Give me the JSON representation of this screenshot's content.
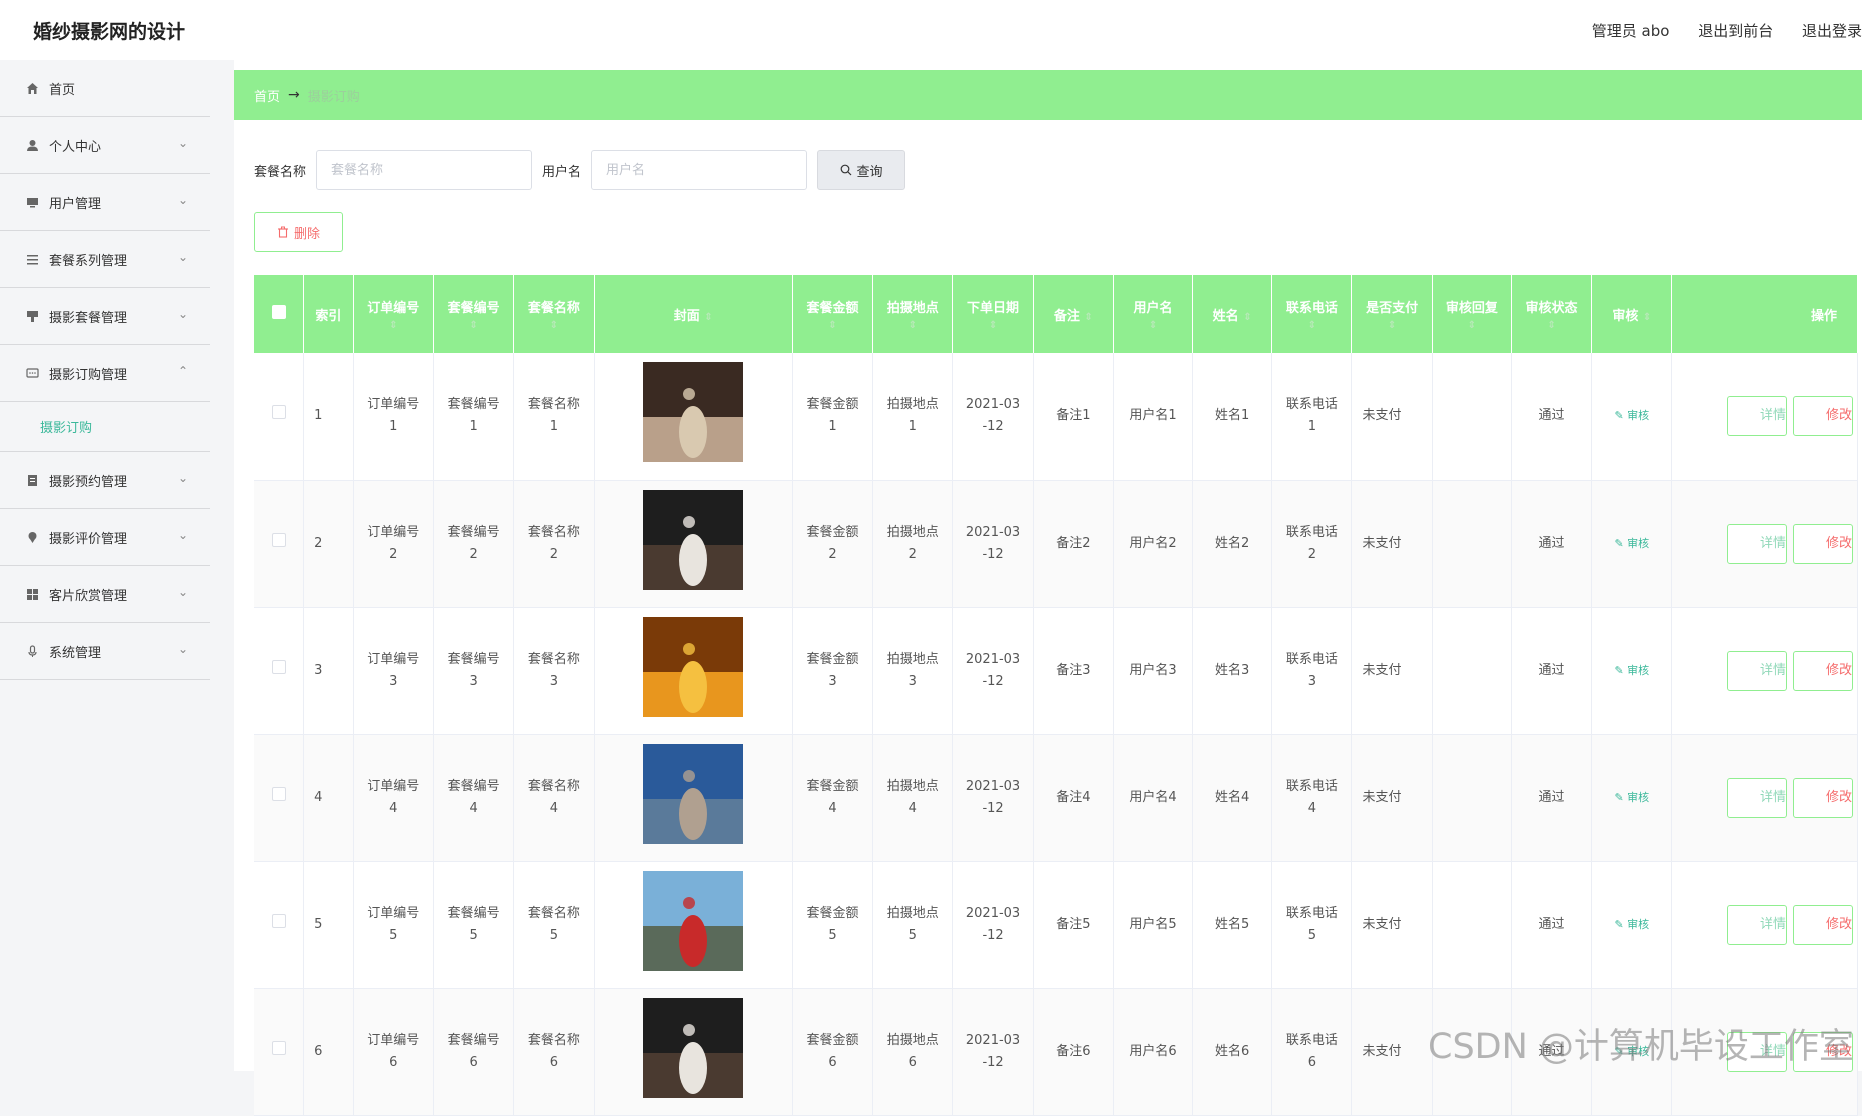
{
  "header": {
    "title": "婚纱摄影网的设计",
    "admin": "管理员 abo",
    "to_front": "退出到前台",
    "logout": "退出登录"
  },
  "sidebar": {
    "items": [
      {
        "label": "首页",
        "icon": "home-icon"
      },
      {
        "label": "个人中心",
        "icon": "user-icon"
      },
      {
        "label": "用户管理",
        "icon": "monitor-icon"
      },
      {
        "label": "套餐系列管理",
        "icon": "list-icon"
      },
      {
        "label": "摄影套餐管理",
        "icon": "brush-icon"
      },
      {
        "label": "摄影订购管理",
        "icon": "chat-icon",
        "sub": "摄影订购"
      },
      {
        "label": "摄影预约管理",
        "icon": "document-icon"
      },
      {
        "label": "摄影评价管理",
        "icon": "pin-icon"
      },
      {
        "label": "客片欣赏管理",
        "icon": "grid-icon"
      },
      {
        "label": "系统管理",
        "icon": "mic-icon"
      }
    ]
  },
  "breadcrumb": {
    "home": "首页",
    "current": "摄影订购"
  },
  "search": {
    "package_label": "套餐名称",
    "package_placeholder": "套餐名称",
    "user_label": "用户名",
    "user_placeholder": "用户名",
    "query_label": "查询"
  },
  "delete_label": "删除",
  "table": {
    "headers": [
      "索引",
      "订单编号",
      "套餐编号",
      "套餐名称",
      "封面",
      "套餐金额",
      "拍摄地点",
      "下单日期",
      "备注",
      "用户名",
      "姓名",
      "联系电话",
      "是否支付",
      "审核回复",
      "审核状态",
      "审核",
      "操作"
    ],
    "rows": [
      {
        "index": "1",
        "order_no": "订单编号\n1",
        "pkg_no": "套餐编号\n1",
        "pkg_name": "套餐名称\n1",
        "amount": "套餐金额\n1",
        "place": "拍摄地点\n1",
        "date": "2021-03\n-12",
        "note": "备注1",
        "username": "用户名1",
        "name": "姓名1",
        "phone": "联系电话\n1",
        "paid": "未支付",
        "reply": "",
        "status": "通过",
        "audit": "审核",
        "detail": "详情",
        "edit": "修改",
        "cover_colors": [
          "#3a2a22",
          "#b9a08a",
          "#d9c9b0"
        ]
      },
      {
        "index": "2",
        "order_no": "订单编号\n2",
        "pkg_no": "套餐编号\n2",
        "pkg_name": "套餐名称\n2",
        "amount": "套餐金额\n2",
        "place": "拍摄地点\n2",
        "date": "2021-03\n-12",
        "note": "备注2",
        "username": "用户名2",
        "name": "姓名2",
        "phone": "联系电话\n2",
        "paid": "未支付",
        "reply": "",
        "status": "通过",
        "audit": "审核",
        "detail": "详情",
        "edit": "修改",
        "cover_colors": [
          "#1e1e1e",
          "#4a3a30",
          "#e8e4de"
        ]
      },
      {
        "index": "3",
        "order_no": "订单编号\n3",
        "pkg_no": "套餐编号\n3",
        "pkg_name": "套餐名称\n3",
        "amount": "套餐金额\n3",
        "place": "拍摄地点\n3",
        "date": "2021-03\n-12",
        "note": "备注3",
        "username": "用户名3",
        "name": "姓名3",
        "phone": "联系电话\n3",
        "paid": "未支付",
        "reply": "",
        "status": "通过",
        "audit": "审核",
        "detail": "详情",
        "edit": "修改",
        "cover_colors": [
          "#7a3a08",
          "#e8961e",
          "#f5c040"
        ]
      },
      {
        "index": "4",
        "order_no": "订单编号\n4",
        "pkg_no": "套餐编号\n4",
        "pkg_name": "套餐名称\n4",
        "amount": "套餐金额\n4",
        "place": "拍摄地点\n4",
        "date": "2021-03\n-12",
        "note": "备注4",
        "username": "用户名4",
        "name": "姓名4",
        "phone": "联系电话\n4",
        "paid": "未支付",
        "reply": "",
        "status": "通过",
        "audit": "审核",
        "detail": "详情",
        "edit": "修改",
        "cover_colors": [
          "#2a5a9a",
          "#5a7a9a",
          "#b0a090"
        ]
      },
      {
        "index": "5",
        "order_no": "订单编号\n5",
        "pkg_no": "套餐编号\n5",
        "pkg_name": "套餐名称\n5",
        "amount": "套餐金额\n5",
        "place": "拍摄地点\n5",
        "date": "2021-03\n-12",
        "note": "备注5",
        "username": "用户名5",
        "name": "姓名5",
        "phone": "联系电话\n5",
        "paid": "未支付",
        "reply": "",
        "status": "通过",
        "audit": "审核",
        "detail": "详情",
        "edit": "修改",
        "cover_colors": [
          "#7ab0d8",
          "#5a6a5a",
          "#c82a2a"
        ]
      },
      {
        "index": "6",
        "order_no": "订单编号\n6",
        "pkg_no": "套餐编号\n6",
        "pkg_name": "套餐名称\n6",
        "amount": "套餐金额\n6",
        "place": "拍摄地点\n6",
        "date": "2021-03\n-12",
        "note": "备注6",
        "username": "用户名6",
        "name": "姓名6",
        "phone": "联系电话\n6",
        "paid": "未支付",
        "reply": "",
        "status": "通过",
        "audit": "审核",
        "detail": "详情",
        "edit": "修改",
        "cover_colors": [
          "#1e1e1e",
          "#4a3a30",
          "#e8e4de"
        ]
      }
    ]
  },
  "watermark": "CSDN @计算机毕设工作室",
  "colors": {
    "accent": "#90ee90",
    "active_text": "#3bb89a",
    "danger": "#f56c6c"
  }
}
